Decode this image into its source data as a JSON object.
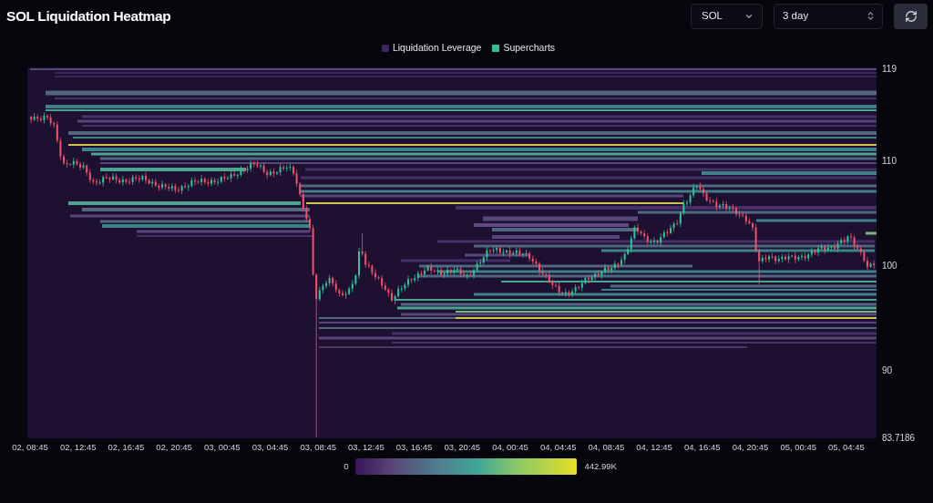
{
  "header": {
    "title": "SOL Liquidation Heatmap",
    "symbol_select": {
      "value": "SOL"
    },
    "range_select": {
      "value": "3 day"
    }
  },
  "legend": {
    "items": [
      {
        "label": "Liquidation Leverage",
        "color": "#3d2460"
      },
      {
        "label": "Supercharts",
        "color": "#2ec28f"
      }
    ]
  },
  "chart": {
    "price_axis": {
      "ticks": [
        "119",
        "110",
        "100",
        "90",
        "83.7186"
      ]
    },
    "time_axis": {
      "ticks": [
        "02, 08:45",
        "02, 12:45",
        "02, 16:45",
        "02, 20:45",
        "03, 00:45",
        "03, 04:45",
        "03, 08:45",
        "03, 12:45",
        "03, 16:45",
        "03, 20:45",
        "04, 00:45",
        "04, 04:45",
        "04, 08:45",
        "04, 12:45",
        "04, 16:45",
        "04, 20:45",
        "05, 00:45",
        "05, 04:45"
      ]
    }
  },
  "color_scale": {
    "min_label": "0",
    "max_label": "442.99K"
  }
}
